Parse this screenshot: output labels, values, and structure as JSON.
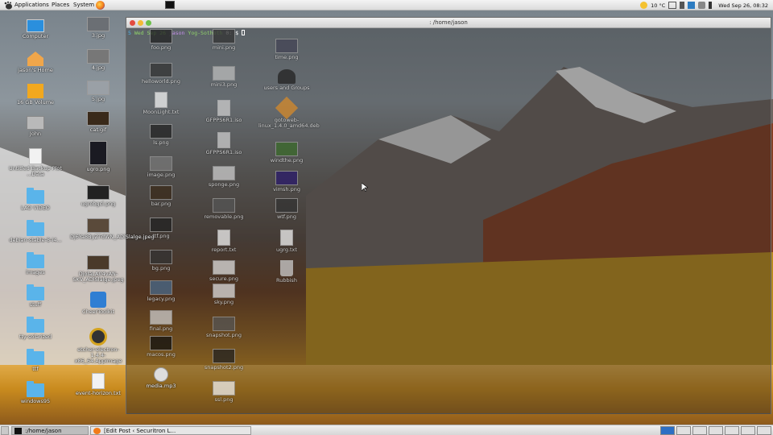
{
  "top_panel": {
    "menus": [
      "Applications",
      "Places",
      "System"
    ],
    "weather": "10 °C",
    "clock": "Wed Sep 26, 08:32"
  },
  "terminal": {
    "title": ": /home/jason",
    "prompt": {
      "num": "5",
      "date": "Wed Sep 26",
      "user": "jason",
      "host": "Yog-Sothoth",
      "dir": "0: $"
    }
  },
  "desktop_icons": [
    {
      "label": "Computer"
    },
    {
      "label": "jason's Home"
    },
    {
      "label": "16 GB Volume"
    },
    {
      "label": "John"
    },
    {
      "label": "Untitled Backup Plot ...Data"
    },
    {
      "label": "LAO VIDEO"
    },
    {
      "label": "debian-stable-8-i4..."
    },
    {
      "label": "images"
    },
    {
      "label": "stuff"
    },
    {
      "label": "tty-solarized"
    },
    {
      "label": "ttf"
    },
    {
      "label": "windows95"
    },
    {
      "label": "3.jpg"
    },
    {
      "label": "4.jpg"
    },
    {
      "label": "5.jpg"
    },
    {
      "label": "cat.gif"
    },
    {
      "label": "ugro.png"
    },
    {
      "label": "ugrobgcl.png"
    },
    {
      "label": "Dj6Ya8ByZTdWN_ADlSlalge.jpeg"
    },
    {
      "label": "DjolaLA04vAN-SKV_ADlSlalge.jpeg"
    },
    {
      "label": "CheerToolkit"
    },
    {
      "label": "etcher-electron-1.4.4-x86_64.AppImage"
    },
    {
      "label": "event-horizon.txt"
    },
    {
      "label": "media.mp3"
    }
  ],
  "term_icons": [
    {
      "label": "foo.png"
    },
    {
      "label": "mini.png"
    },
    {
      "label": "time.png"
    },
    {
      "label": "helloworld.png"
    },
    {
      "label": "mini3.png"
    },
    {
      "label": "users and Groups"
    },
    {
      "label": "MoonLight.txt"
    },
    {
      "label": "GFPPS6R1.iso"
    },
    {
      "label": "gotoweb-linux_1.4.0_amd64.deb"
    },
    {
      "label": "ls.png"
    },
    {
      "label": "GFPPS6R1.iso"
    },
    {
      "label": "windthe.png"
    },
    {
      "label": "image.png"
    },
    {
      "label": "sponge.png"
    },
    {
      "label": "vimsh.png"
    },
    {
      "label": "bar.png"
    },
    {
      "label": "removable.png"
    },
    {
      "label": "wtf.png"
    },
    {
      "label": "ttf.png"
    },
    {
      "label": "report.txt"
    },
    {
      "label": "ugrg.txt"
    },
    {
      "label": "bg.png"
    },
    {
      "label": "secure.png"
    },
    {
      "label": "Rubbish"
    },
    {
      "label": "legacy.png"
    },
    {
      "label": "sky.png"
    },
    {
      "label": "final.png"
    },
    {
      "label": "snapshot.png"
    },
    {
      "label": "macos.png"
    },
    {
      "label": "snapshot2.png"
    },
    {
      "label": "ssl.png"
    }
  ],
  "taskbar": {
    "items": [
      ":/home/jason",
      "[Edit Post ‹ Securitron L..."
    ]
  }
}
